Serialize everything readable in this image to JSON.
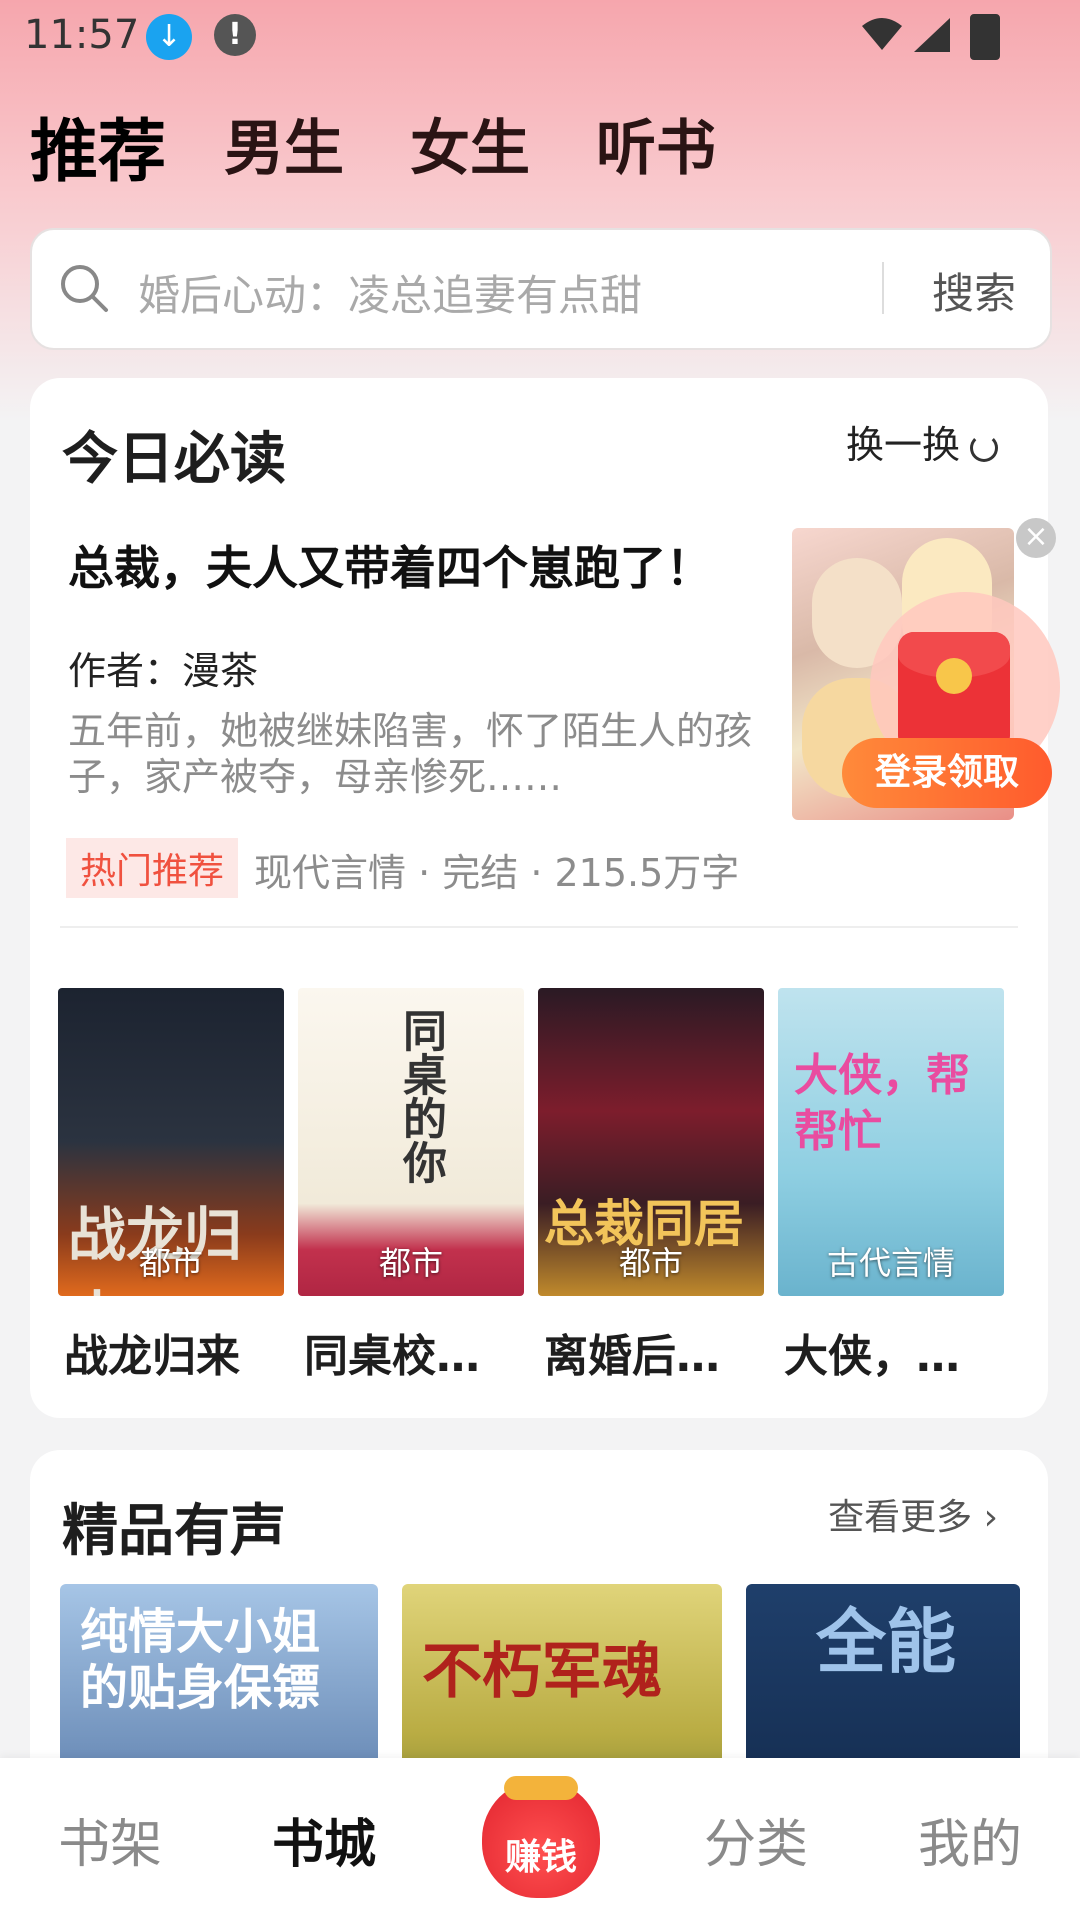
{
  "status": {
    "time": "11:57"
  },
  "top_tabs": [
    "推荐",
    "男生",
    "女生",
    "听书"
  ],
  "search": {
    "placeholder": "婚后心动：凌总追妻有点甜",
    "button": "搜索"
  },
  "today": {
    "title": "今日必读",
    "refresh": "换一换",
    "featured": {
      "title": "总裁，夫人又带着四个崽跑了！",
      "author": "作者：漫茶",
      "description": "五年前，她被继妹陷害，怀了陌生人的孩子，家产被夺，母亲惨死……",
      "tag": "热门推荐",
      "meta": "现代言情 · 完结 · 215.5万字"
    },
    "promo": {
      "label": "登录领取"
    },
    "books": [
      {
        "genre": "都市",
        "title": "战龙归来",
        "cover_text": "战龙归来"
      },
      {
        "genre": "都市",
        "title": "同桌校…",
        "cover_text": "同桌的你"
      },
      {
        "genre": "都市",
        "title": "离婚后…",
        "cover_text": "总裁同居"
      },
      {
        "genre": "古代言情",
        "title": "大侠，…",
        "cover_text": "大侠，帮帮忙"
      }
    ]
  },
  "audio": {
    "title": "精品有声",
    "more": "查看更多",
    "covers": [
      "纯情大小姐的贴身保镖",
      "不朽军魂",
      "全能"
    ]
  },
  "bottom_nav": {
    "shelf": "书架",
    "store": "书城",
    "earn": "赚钱",
    "category": "分类",
    "mine": "我的"
  },
  "colors": {
    "accent": "#f0513f",
    "promo": "#ff5b2d"
  }
}
